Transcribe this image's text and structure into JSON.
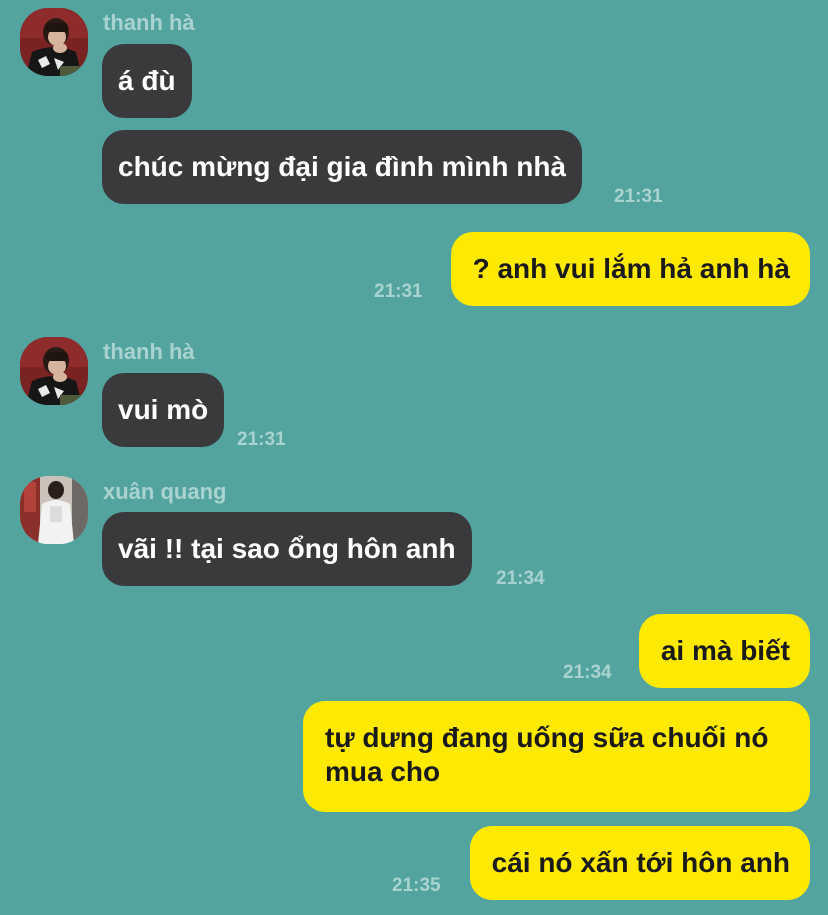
{
  "messages": [
    {
      "sender": "thanh hà",
      "text": "á đù",
      "time": ""
    },
    {
      "sender": "",
      "text": "chúc mừng đại gia đình mình nhà",
      "time": "21:31"
    },
    {
      "sender": "",
      "text": "? anh vui lắm hả anh hà",
      "time": "21:31"
    },
    {
      "sender": "thanh hà",
      "text": "vui mò",
      "time": "21:31"
    },
    {
      "sender": "xuân quang",
      "text": "vãi !! tại sao ổng hôn anh",
      "time": "21:34"
    },
    {
      "sender": "",
      "text": "ai mà biết",
      "time": "21:34"
    },
    {
      "sender": "",
      "text": "tự dưng đang uống sữa chuối nó mua cho",
      "time": ""
    },
    {
      "sender": "",
      "text": "cái nó xấn tới hôn anh",
      "time": "21:35"
    }
  ],
  "colors": {
    "background": "#53a49f",
    "incoming_bubble": "#3a3a3c",
    "outgoing_bubble": "#fde902",
    "meta_text": "#a9d3cf"
  }
}
